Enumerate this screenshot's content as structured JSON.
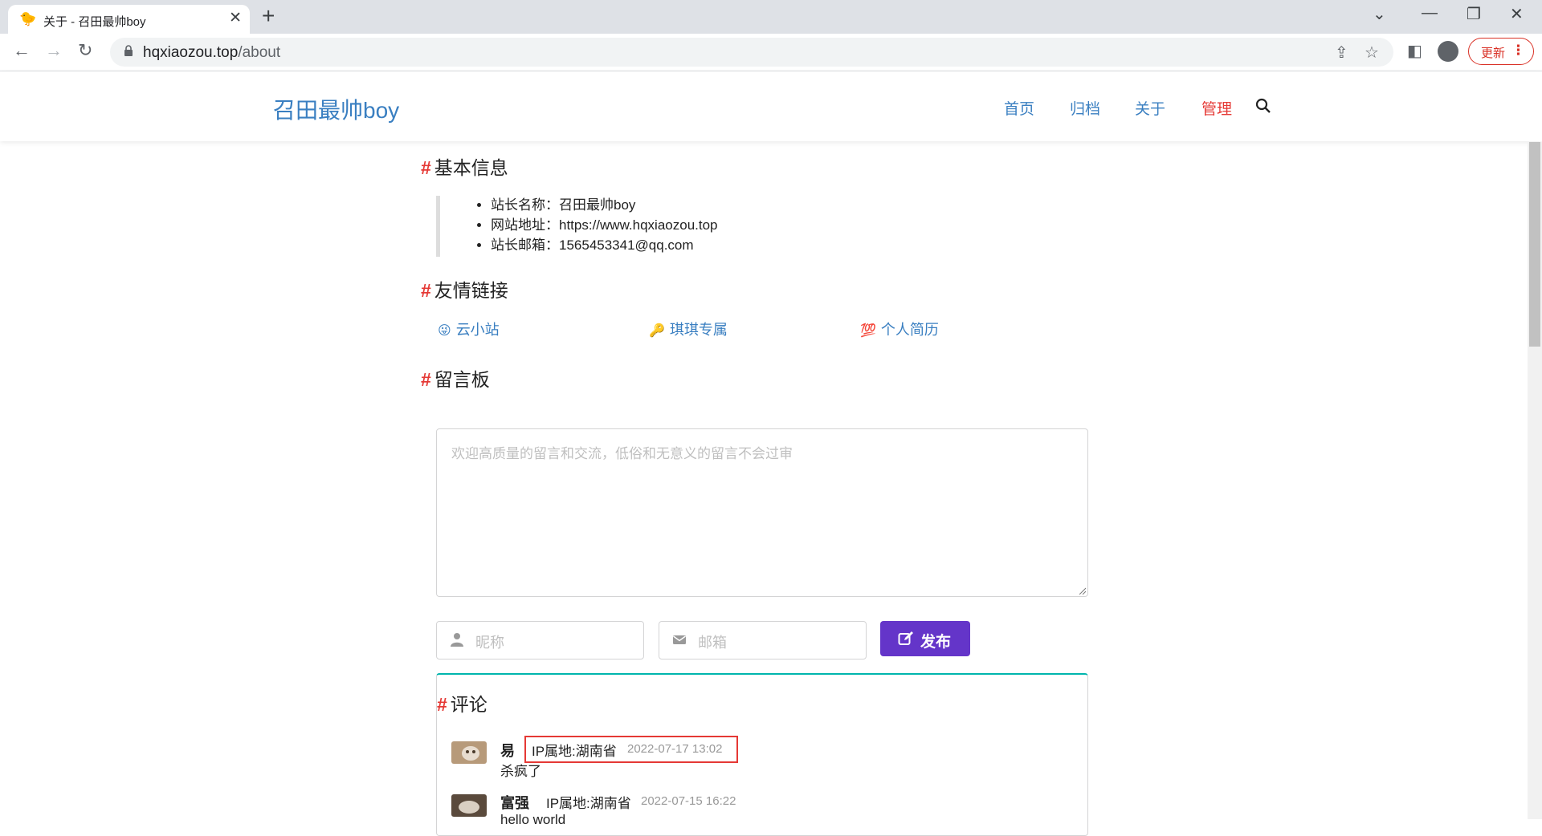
{
  "browser": {
    "tab_title": "关于 - 召田最帅boy",
    "url_host": "hqxiaozou.top",
    "url_path": "/about",
    "update_label": "更新"
  },
  "site": {
    "title": "召田最帅boy",
    "nav": [
      "首页",
      "归档",
      "关于",
      "管理"
    ],
    "colors": {
      "accent": "#3a7fc1",
      "admin": "#e53935",
      "publish": "#6435c9",
      "hash": "#e53935"
    }
  },
  "basic_info": {
    "heading": "基本信息",
    "items": [
      "站长名称：召田最帅boy",
      "网站地址：https://www.hqxiaozou.top",
      "站长邮箱：1565453341@qq.com"
    ]
  },
  "friend_links": {
    "heading": "友情链接",
    "links": [
      {
        "emoji": "😜",
        "label": "云小站"
      },
      {
        "emoji": "🔑",
        "label": "琪琪专属"
      },
      {
        "emoji": "💯",
        "label": "个人简历"
      }
    ]
  },
  "guestbook": {
    "heading": "留言板",
    "textarea_placeholder": "欢迎高质量的留言和交流，低俗和无意义的留言不会过审",
    "nickname_placeholder": "昵称",
    "email_placeholder": "邮箱",
    "publish_label": "发布"
  },
  "comments": {
    "heading": "评论",
    "items": [
      {
        "name": "易",
        "ip": "IP属地:湖南省",
        "date": "2022-07-17 13:02",
        "text": "杀疯了"
      },
      {
        "name": "富强",
        "ip": "IP属地:湖南省",
        "date": "2022-07-15 16:22",
        "text": "hello world"
      }
    ]
  },
  "icons": [
    "duck-favicon-icon",
    "close-icon",
    "plus-icon",
    "back-icon",
    "forward-icon",
    "reload-icon",
    "lock-icon",
    "share-icon",
    "star-icon",
    "sidepanel-icon",
    "profile-icon",
    "kebab-menu-icon",
    "search-icon",
    "user-icon",
    "mail-icon",
    "edit-icon"
  ]
}
